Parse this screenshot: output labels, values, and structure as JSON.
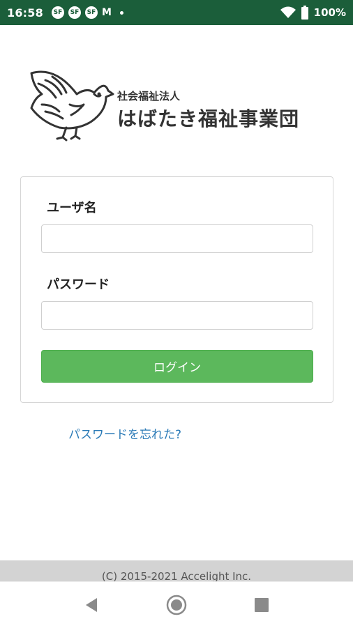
{
  "status_bar": {
    "time": "16:58",
    "notification_icons": [
      "SF",
      "SF",
      "SF"
    ],
    "mail_icon": "M",
    "battery": "100%"
  },
  "logo": {
    "subtitle": "社会福祉法人",
    "title": "はばたき福祉事業団"
  },
  "form": {
    "username_label": "ユーザ名",
    "username_value": "",
    "password_label": "パスワード",
    "password_value": "",
    "login_button": "ログイン"
  },
  "forgot_password": "パスワードを忘れた?",
  "footer": {
    "copyright": "(C) 2015-2021 Accelight Inc."
  },
  "colors": {
    "status_bar": "#1b5e3a",
    "button": "#5cb85c",
    "link": "#2a7ab7"
  }
}
